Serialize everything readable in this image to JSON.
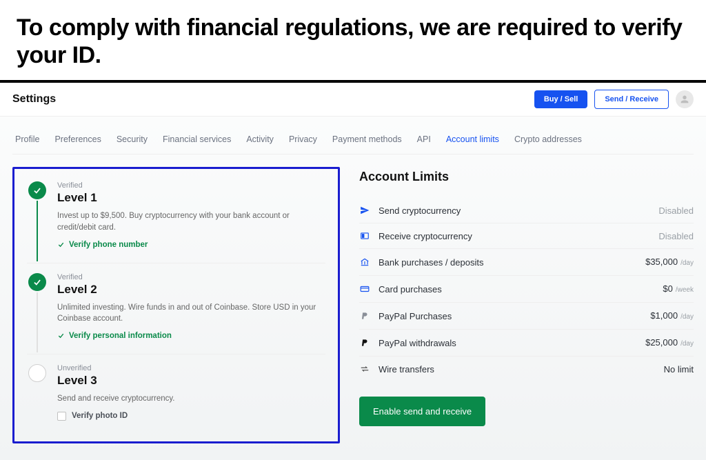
{
  "hero": {
    "title": "To comply with financial regulations, we are required to verify your ID."
  },
  "topbar": {
    "title": "Settings",
    "buy_sell": "Buy / Sell",
    "send_receive": "Send / Receive"
  },
  "tabs": [
    "Profile",
    "Preferences",
    "Security",
    "Financial services",
    "Activity",
    "Privacy",
    "Payment methods",
    "API",
    "Account limits",
    "Crypto addresses"
  ],
  "tabs_active_index": 8,
  "levels": [
    {
      "status": "Verified",
      "title": "Level 1",
      "desc": "Invest up to $9,500. Buy cryptocurrency with your bank account or credit/debit card.",
      "step": "Verify phone number",
      "complete": true
    },
    {
      "status": "Verified",
      "title": "Level 2",
      "desc": "Unlimited investing. Wire funds in and out of Coinbase. Store USD in your Coinbase account.",
      "step": "Verify personal information",
      "complete": true
    },
    {
      "status": "Unverified",
      "title": "Level 3",
      "desc": "Send and receive cryptocurrency.",
      "step": "Verify photo ID",
      "complete": false
    }
  ],
  "limits": {
    "title": "Account Limits",
    "items": [
      {
        "icon": "send",
        "label": "Send cryptocurrency",
        "value": "Disabled",
        "period": "",
        "muted": true
      },
      {
        "icon": "receive",
        "label": "Receive cryptocurrency",
        "value": "Disabled",
        "period": "",
        "muted": true
      },
      {
        "icon": "bank",
        "label": "Bank purchases / deposits",
        "value": "$35,000",
        "period": "/day",
        "muted": false
      },
      {
        "icon": "card",
        "label": "Card purchases",
        "value": "$0",
        "period": "/week",
        "muted": false
      },
      {
        "icon": "paypal",
        "label": "PayPal Purchases",
        "value": "$1,000",
        "period": "/day",
        "muted": false
      },
      {
        "icon": "paypal-bold",
        "label": "PayPal withdrawals",
        "value": "$25,000",
        "period": "/day",
        "muted": false
      },
      {
        "icon": "wire",
        "label": "Wire transfers",
        "value": "No limit",
        "period": "",
        "muted": false
      }
    ],
    "enable_button": "Enable send and receive"
  }
}
